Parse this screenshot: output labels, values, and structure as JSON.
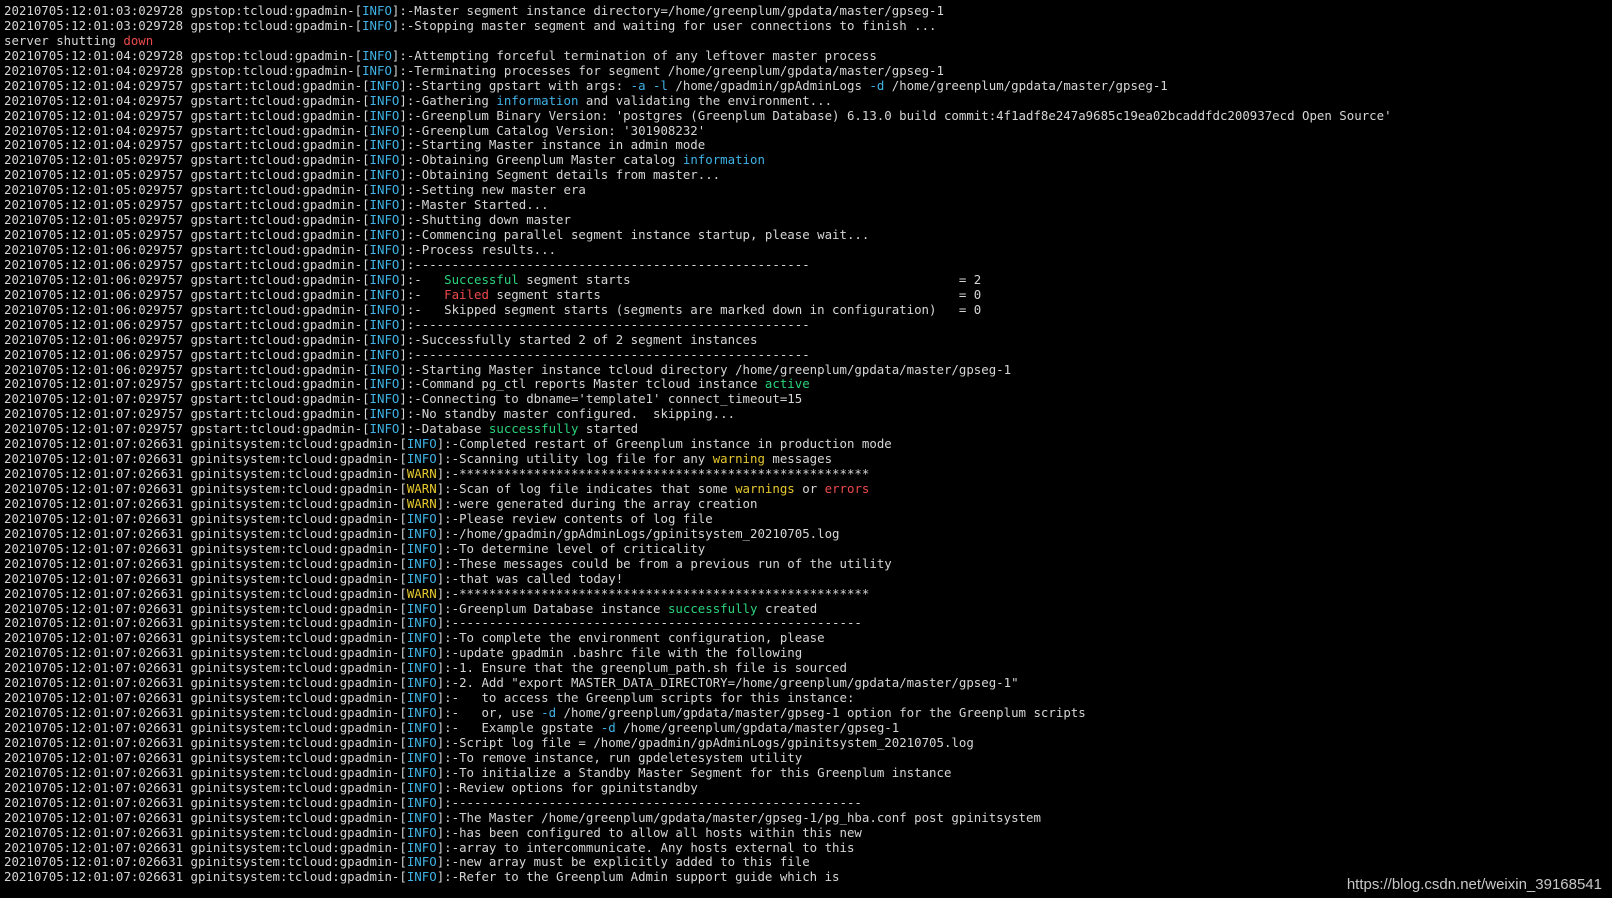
{
  "colors": {
    "background": "#000000",
    "default_text": "#d6d6d6",
    "info_tag": "#3fb3e6",
    "warn_tag": "#e5c82e",
    "success": "#2bd37a",
    "error": "#ec4a4a"
  },
  "watermark": "https://blog.csdn.net/weixin_39168541",
  "lines": [
    [
      [
        "20210705:12:01:03:029728 gpstop:tcloud:gpadmin-[",
        "default"
      ],
      [
        "INFO",
        "blue"
      ],
      [
        "]:-Master segment instance directory=/home/greenplum/gpdata/master/gpseg-1",
        "default"
      ]
    ],
    [
      [
        "20210705:12:01:03:029728 gpstop:tcloud:gpadmin-[",
        "default"
      ],
      [
        "INFO",
        "blue"
      ],
      [
        "]:-Stopping master segment and waiting for user connections to finish ...",
        "default"
      ]
    ],
    [
      [
        "server shutting ",
        "default"
      ],
      [
        "down",
        "red"
      ]
    ],
    [
      [
        "20210705:12:01:04:029728 gpstop:tcloud:gpadmin-[",
        "default"
      ],
      [
        "INFO",
        "blue"
      ],
      [
        "]:-Attempting forceful termination of any leftover master process",
        "default"
      ]
    ],
    [
      [
        "20210705:12:01:04:029728 gpstop:tcloud:gpadmin-[",
        "default"
      ],
      [
        "INFO",
        "blue"
      ],
      [
        "]:-Terminating processes for segment /home/greenplum/gpdata/master/gpseg-1",
        "default"
      ]
    ],
    [
      [
        "20210705:12:01:04:029757 gpstart:tcloud:gpadmin-[",
        "default"
      ],
      [
        "INFO",
        "blue"
      ],
      [
        "]:-Starting gpstart with args: ",
        "default"
      ],
      [
        "-a -l",
        "blue"
      ],
      [
        " /home/gpadmin/gpAdminLogs ",
        "default"
      ],
      [
        "-d",
        "blue"
      ],
      [
        " /home/greenplum/gpdata/master/gpseg-1",
        "default"
      ]
    ],
    [
      [
        "20210705:12:01:04:029757 gpstart:tcloud:gpadmin-[",
        "default"
      ],
      [
        "INFO",
        "blue"
      ],
      [
        "]:-Gathering ",
        "default"
      ],
      [
        "information",
        "blue"
      ],
      [
        " and validating the environment...",
        "default"
      ]
    ],
    [
      [
        "20210705:12:01:04:029757 gpstart:tcloud:gpadmin-[",
        "default"
      ],
      [
        "INFO",
        "blue"
      ],
      [
        "]:-Greenplum Binary Version: 'postgres (Greenplum Database) 6.13.0 build commit:4f1adf8e247a9685c19ea02bcaddfdc200937ecd Open Source'",
        "default"
      ]
    ],
    [
      [
        "20210705:12:01:04:029757 gpstart:tcloud:gpadmin-[",
        "default"
      ],
      [
        "INFO",
        "blue"
      ],
      [
        "]:-Greenplum Catalog Version: '301908232'",
        "default"
      ]
    ],
    [
      [
        "20210705:12:01:04:029757 gpstart:tcloud:gpadmin-[",
        "default"
      ],
      [
        "INFO",
        "blue"
      ],
      [
        "]:-Starting Master instance in admin mode",
        "default"
      ]
    ],
    [
      [
        "20210705:12:01:05:029757 gpstart:tcloud:gpadmin-[",
        "default"
      ],
      [
        "INFO",
        "blue"
      ],
      [
        "]:-Obtaining Greenplum Master catalog ",
        "default"
      ],
      [
        "information",
        "blue"
      ]
    ],
    [
      [
        "20210705:12:01:05:029757 gpstart:tcloud:gpadmin-[",
        "default"
      ],
      [
        "INFO",
        "blue"
      ],
      [
        "]:-Obtaining Segment details from master...",
        "default"
      ]
    ],
    [
      [
        "20210705:12:01:05:029757 gpstart:tcloud:gpadmin-[",
        "default"
      ],
      [
        "INFO",
        "blue"
      ],
      [
        "]:-Setting new master era",
        "default"
      ]
    ],
    [
      [
        "20210705:12:01:05:029757 gpstart:tcloud:gpadmin-[",
        "default"
      ],
      [
        "INFO",
        "blue"
      ],
      [
        "]:-Master Started...",
        "default"
      ]
    ],
    [
      [
        "20210705:12:01:05:029757 gpstart:tcloud:gpadmin-[",
        "default"
      ],
      [
        "INFO",
        "blue"
      ],
      [
        "]:-Shutting down master",
        "default"
      ]
    ],
    [
      [
        "20210705:12:01:05:029757 gpstart:tcloud:gpadmin-[",
        "default"
      ],
      [
        "INFO",
        "blue"
      ],
      [
        "]:-Commencing parallel segment instance startup, please wait...",
        "default"
      ]
    ],
    [
      [
        "20210705:12:01:06:029757 gpstart:tcloud:gpadmin-[",
        "default"
      ],
      [
        "INFO",
        "blue"
      ],
      [
        "]:-Process results...",
        "default"
      ]
    ],
    [
      [
        "20210705:12:01:06:029757 gpstart:tcloud:gpadmin-[",
        "default"
      ],
      [
        "INFO",
        "blue"
      ],
      [
        "]:-----------------------------------------------------",
        "default"
      ]
    ],
    [
      [
        "20210705:12:01:06:029757 gpstart:tcloud:gpadmin-[",
        "default"
      ],
      [
        "INFO",
        "blue"
      ],
      [
        "]:-   ",
        "default"
      ],
      [
        "Successful",
        "green"
      ],
      [
        " segment starts                                            = 2",
        "default"
      ]
    ],
    [
      [
        "20210705:12:01:06:029757 gpstart:tcloud:gpadmin-[",
        "default"
      ],
      [
        "INFO",
        "blue"
      ],
      [
        "]:-   ",
        "default"
      ],
      [
        "Failed",
        "red"
      ],
      [
        " segment starts                                                = 0",
        "default"
      ]
    ],
    [
      [
        "20210705:12:01:06:029757 gpstart:tcloud:gpadmin-[",
        "default"
      ],
      [
        "INFO",
        "blue"
      ],
      [
        "]:-   Skipped segment starts (segments are marked down in configuration)   = 0",
        "default"
      ]
    ],
    [
      [
        "20210705:12:01:06:029757 gpstart:tcloud:gpadmin-[",
        "default"
      ],
      [
        "INFO",
        "blue"
      ],
      [
        "]:-----------------------------------------------------",
        "default"
      ]
    ],
    [
      [
        "20210705:12:01:06:029757 gpstart:tcloud:gpadmin-[",
        "default"
      ],
      [
        "INFO",
        "blue"
      ],
      [
        "]:-Successfully started 2 of 2 segment instances",
        "default"
      ]
    ],
    [
      [
        "20210705:12:01:06:029757 gpstart:tcloud:gpadmin-[",
        "default"
      ],
      [
        "INFO",
        "blue"
      ],
      [
        "]:-----------------------------------------------------",
        "default"
      ]
    ],
    [
      [
        "20210705:12:01:06:029757 gpstart:tcloud:gpadmin-[",
        "default"
      ],
      [
        "INFO",
        "blue"
      ],
      [
        "]:-Starting Master instance tcloud directory /home/greenplum/gpdata/master/gpseg-1",
        "default"
      ]
    ],
    [
      [
        "20210705:12:01:07:029757 gpstart:tcloud:gpadmin-[",
        "default"
      ],
      [
        "INFO",
        "blue"
      ],
      [
        "]:-Command pg_ctl reports Master tcloud instance ",
        "default"
      ],
      [
        "active",
        "green"
      ]
    ],
    [
      [
        "20210705:12:01:07:029757 gpstart:tcloud:gpadmin-[",
        "default"
      ],
      [
        "INFO",
        "blue"
      ],
      [
        "]:-Connecting to dbname='template1' connect_timeout=15",
        "default"
      ]
    ],
    [
      [
        "20210705:12:01:07:029757 gpstart:tcloud:gpadmin-[",
        "default"
      ],
      [
        "INFO",
        "blue"
      ],
      [
        "]:-No standby master configured.  skipping...",
        "default"
      ]
    ],
    [
      [
        "20210705:12:01:07:029757 gpstart:tcloud:gpadmin-[",
        "default"
      ],
      [
        "INFO",
        "blue"
      ],
      [
        "]:-Database ",
        "default"
      ],
      [
        "successfully",
        "green"
      ],
      [
        " started",
        "default"
      ]
    ],
    [
      [
        "20210705:12:01:07:026631 gpinitsystem:tcloud:gpadmin-[",
        "default"
      ],
      [
        "INFO",
        "blue"
      ],
      [
        "]:-Completed restart of Greenplum instance in production mode",
        "default"
      ]
    ],
    [
      [
        "20210705:12:01:07:026631 gpinitsystem:tcloud:gpadmin-[",
        "default"
      ],
      [
        "INFO",
        "blue"
      ],
      [
        "]:-Scanning utility log file for any ",
        "default"
      ],
      [
        "warning",
        "yellow"
      ],
      [
        " messages",
        "default"
      ]
    ],
    [
      [
        "20210705:12:01:07:026631 gpinitsystem:tcloud:gpadmin-[",
        "default"
      ],
      [
        "WARN",
        "yellow"
      ],
      [
        "]:-*******************************************************",
        "default"
      ]
    ],
    [
      [
        "20210705:12:01:07:026631 gpinitsystem:tcloud:gpadmin-[",
        "default"
      ],
      [
        "WARN",
        "yellow"
      ],
      [
        "]:-Scan of log file indicates that some ",
        "default"
      ],
      [
        "warnings",
        "yellow"
      ],
      [
        " or ",
        "default"
      ],
      [
        "errors",
        "red"
      ]
    ],
    [
      [
        "20210705:12:01:07:026631 gpinitsystem:tcloud:gpadmin-[",
        "default"
      ],
      [
        "WARN",
        "yellow"
      ],
      [
        "]:-were generated during the array creation",
        "default"
      ]
    ],
    [
      [
        "20210705:12:01:07:026631 gpinitsystem:tcloud:gpadmin-[",
        "default"
      ],
      [
        "INFO",
        "blue"
      ],
      [
        "]:-Please review contents of log file",
        "default"
      ]
    ],
    [
      [
        "20210705:12:01:07:026631 gpinitsystem:tcloud:gpadmin-[",
        "default"
      ],
      [
        "INFO",
        "blue"
      ],
      [
        "]:-/home/gpadmin/gpAdminLogs/gpinitsystem_20210705.log",
        "default"
      ]
    ],
    [
      [
        "20210705:12:01:07:026631 gpinitsystem:tcloud:gpadmin-[",
        "default"
      ],
      [
        "INFO",
        "blue"
      ],
      [
        "]:-To determine level of criticality",
        "default"
      ]
    ],
    [
      [
        "20210705:12:01:07:026631 gpinitsystem:tcloud:gpadmin-[",
        "default"
      ],
      [
        "INFO",
        "blue"
      ],
      [
        "]:-These messages could be from a previous run of the utility",
        "default"
      ]
    ],
    [
      [
        "20210705:12:01:07:026631 gpinitsystem:tcloud:gpadmin-[",
        "default"
      ],
      [
        "INFO",
        "blue"
      ],
      [
        "]:-that was called today!",
        "default"
      ]
    ],
    [
      [
        "20210705:12:01:07:026631 gpinitsystem:tcloud:gpadmin-[",
        "default"
      ],
      [
        "WARN",
        "yellow"
      ],
      [
        "]:-*******************************************************",
        "default"
      ]
    ],
    [
      [
        "20210705:12:01:07:026631 gpinitsystem:tcloud:gpadmin-[",
        "default"
      ],
      [
        "INFO",
        "blue"
      ],
      [
        "]:-Greenplum Database instance ",
        "default"
      ],
      [
        "successfully",
        "green"
      ],
      [
        " created",
        "default"
      ]
    ],
    [
      [
        "20210705:12:01:07:026631 gpinitsystem:tcloud:gpadmin-[",
        "default"
      ],
      [
        "INFO",
        "blue"
      ],
      [
        "]:-------------------------------------------------------",
        "default"
      ]
    ],
    [
      [
        "20210705:12:01:07:026631 gpinitsystem:tcloud:gpadmin-[",
        "default"
      ],
      [
        "INFO",
        "blue"
      ],
      [
        "]:-To complete the environment configuration, please",
        "default"
      ]
    ],
    [
      [
        "20210705:12:01:07:026631 gpinitsystem:tcloud:gpadmin-[",
        "default"
      ],
      [
        "INFO",
        "blue"
      ],
      [
        "]:-update gpadmin .bashrc file with the following",
        "default"
      ]
    ],
    [
      [
        "20210705:12:01:07:026631 gpinitsystem:tcloud:gpadmin-[",
        "default"
      ],
      [
        "INFO",
        "blue"
      ],
      [
        "]:-1. Ensure that the greenplum_path.sh file is sourced",
        "default"
      ]
    ],
    [
      [
        "20210705:12:01:07:026631 gpinitsystem:tcloud:gpadmin-[",
        "default"
      ],
      [
        "INFO",
        "blue"
      ],
      [
        "]:-2. Add \"export MASTER_DATA_DIRECTORY=/home/greenplum/gpdata/master/gpseg-1\"",
        "default"
      ]
    ],
    [
      [
        "20210705:12:01:07:026631 gpinitsystem:tcloud:gpadmin-[",
        "default"
      ],
      [
        "INFO",
        "blue"
      ],
      [
        "]:-   to access the Greenplum scripts for this instance:",
        "default"
      ]
    ],
    [
      [
        "20210705:12:01:07:026631 gpinitsystem:tcloud:gpadmin-[",
        "default"
      ],
      [
        "INFO",
        "blue"
      ],
      [
        "]:-   or, use ",
        "default"
      ],
      [
        "-d",
        "blue"
      ],
      [
        " /home/greenplum/gpdata/master/gpseg-1 option for the Greenplum scripts",
        "default"
      ]
    ],
    [
      [
        "20210705:12:01:07:026631 gpinitsystem:tcloud:gpadmin-[",
        "default"
      ],
      [
        "INFO",
        "blue"
      ],
      [
        "]:-   Example gpstate ",
        "default"
      ],
      [
        "-d",
        "blue"
      ],
      [
        " /home/greenplum/gpdata/master/gpseg-1",
        "default"
      ]
    ],
    [
      [
        "20210705:12:01:07:026631 gpinitsystem:tcloud:gpadmin-[",
        "default"
      ],
      [
        "INFO",
        "blue"
      ],
      [
        "]:-Script log file = /home/gpadmin/gpAdminLogs/gpinitsystem_20210705.log",
        "default"
      ]
    ],
    [
      [
        "20210705:12:01:07:026631 gpinitsystem:tcloud:gpadmin-[",
        "default"
      ],
      [
        "INFO",
        "blue"
      ],
      [
        "]:-To remove instance, run gpdeletesystem utility",
        "default"
      ]
    ],
    [
      [
        "20210705:12:01:07:026631 gpinitsystem:tcloud:gpadmin-[",
        "default"
      ],
      [
        "INFO",
        "blue"
      ],
      [
        "]:-To initialize a Standby Master Segment for this Greenplum instance",
        "default"
      ]
    ],
    [
      [
        "20210705:12:01:07:026631 gpinitsystem:tcloud:gpadmin-[",
        "default"
      ],
      [
        "INFO",
        "blue"
      ],
      [
        "]:-Review options for gpinitstandby",
        "default"
      ]
    ],
    [
      [
        "20210705:12:01:07:026631 gpinitsystem:tcloud:gpadmin-[",
        "default"
      ],
      [
        "INFO",
        "blue"
      ],
      [
        "]:-------------------------------------------------------",
        "default"
      ]
    ],
    [
      [
        "20210705:12:01:07:026631 gpinitsystem:tcloud:gpadmin-[",
        "default"
      ],
      [
        "INFO",
        "blue"
      ],
      [
        "]:-The Master /home/greenplum/gpdata/master/gpseg-1/pg_hba.conf post gpinitsystem",
        "default"
      ]
    ],
    [
      [
        "20210705:12:01:07:026631 gpinitsystem:tcloud:gpadmin-[",
        "default"
      ],
      [
        "INFO",
        "blue"
      ],
      [
        "]:-has been configured to allow all hosts within this new",
        "default"
      ]
    ],
    [
      [
        "20210705:12:01:07:026631 gpinitsystem:tcloud:gpadmin-[",
        "default"
      ],
      [
        "INFO",
        "blue"
      ],
      [
        "]:-array to intercommunicate. Any hosts external to this",
        "default"
      ]
    ],
    [
      [
        "20210705:12:01:07:026631 gpinitsystem:tcloud:gpadmin-[",
        "default"
      ],
      [
        "INFO",
        "blue"
      ],
      [
        "]:-new array must be explicitly added to this file",
        "default"
      ]
    ],
    [
      [
        "20210705:12:01:07:026631 gpinitsystem:tcloud:gpadmin-[",
        "default"
      ],
      [
        "INFO",
        "blue"
      ],
      [
        "]:-Refer to the Greenplum Admin support guide which is",
        "default"
      ]
    ]
  ]
}
